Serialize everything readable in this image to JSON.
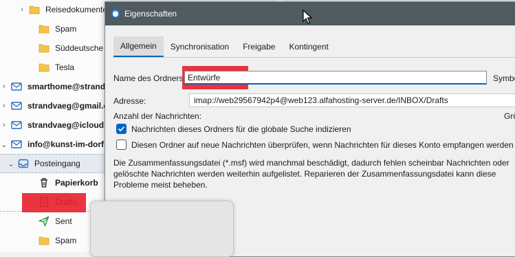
{
  "folder_pane": {
    "rows": [
      {
        "label": "Reisedokumente",
        "icon": "folder-icon",
        "kind": "folder",
        "twisty": "›"
      },
      {
        "label": "Spam",
        "icon": "folder-icon",
        "kind": "folder"
      },
      {
        "label": "Süddeutsche",
        "icon": "folder-icon",
        "kind": "folder"
      },
      {
        "label": "Tesla",
        "icon": "folder-icon",
        "kind": "folder"
      },
      {
        "label": "smarthome@strandv",
        "icon": "mail-account-icon",
        "kind": "account",
        "twisty": "›"
      },
      {
        "label": "strandvaeg@gmail.co",
        "icon": "mail-account-icon",
        "kind": "account",
        "twisty": "›"
      },
      {
        "label": "strandvaeg@icloud.c",
        "icon": "mail-account-icon",
        "kind": "account",
        "twisty": "›"
      },
      {
        "label": "info@kunst-im-dorf.",
        "icon": "mail-account-icon",
        "kind": "account",
        "twisty": "⌄"
      },
      {
        "label": "Posteingang",
        "icon": "inbox-icon",
        "kind": "inbox",
        "twisty": "⌄"
      },
      {
        "label": "Papierkorb",
        "icon": "trash-icon",
        "kind": "trash"
      },
      {
        "label": "Drafts",
        "icon": "drafts-icon",
        "kind": "drafts"
      },
      {
        "label": "Sent",
        "icon": "sent-icon",
        "kind": "sent"
      },
      {
        "label": "Spam",
        "icon": "folder-icon",
        "kind": "folder"
      }
    ]
  },
  "dialog": {
    "title": "Eigenschaften",
    "tabs": [
      "Allgemein",
      "Synchronisation",
      "Freigabe",
      "Kontingent"
    ],
    "active_tab": "Allgemein",
    "name_label": "Name des Ordners:",
    "name_value": "Entwürfe",
    "symbol_label": "Symbo",
    "address_label": "Adresse:",
    "address_value": "imap://web29567942p4@web123.alfahosting-server.de/INBOX/Drafts",
    "message_count_label": "Anzahl der Nachrichten:",
    "size_label": "Grö",
    "checkbox_index": {
      "label": "Nachrichten dieses Ordners für die globale Suche indizieren",
      "checked": true
    },
    "checkbox_check_new": {
      "label": "Diesen Ordner auf neue Nachrichten überprüfen, wenn Nachrichten für dieses Konto empfangen werden",
      "checked": false
    },
    "info_text": "Die Zusammenfassungsdatei (*.msf) wird manchmal beschädigt, dadurch fehlen scheinbar Nachrichten oder gelöschte Nachrichten werden weiterhin aufgelistet. Reparieren der Zusammenfassungsdatei kann diese Probleme meist beheben."
  },
  "colors": {
    "accent": "#0067c0",
    "titlebar": "#4f5b5e",
    "highlight_red": "#e81e2e"
  }
}
